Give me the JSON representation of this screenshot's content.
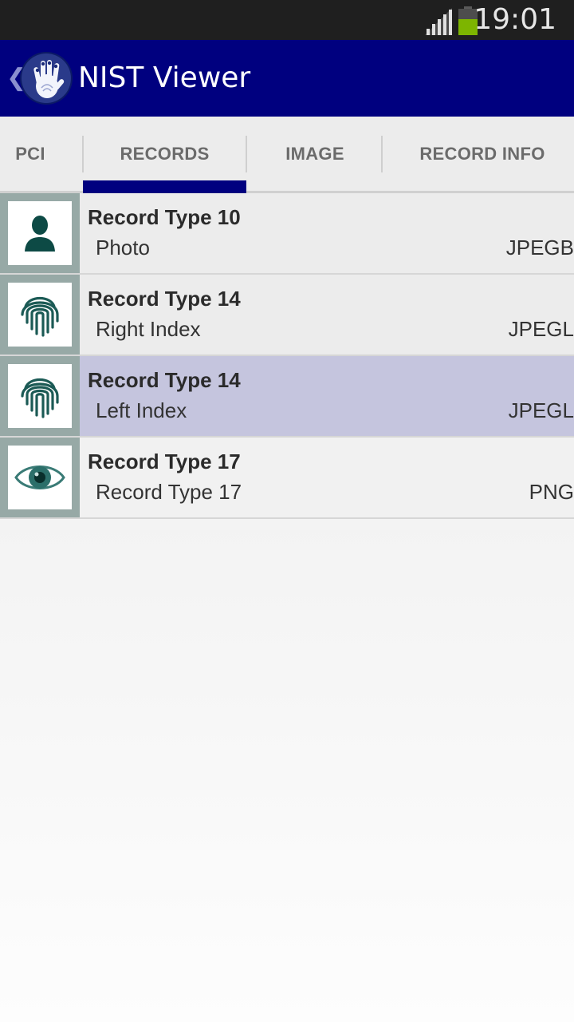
{
  "status_bar": {
    "time": "19:01",
    "signal_icon": "signal-bars-icon",
    "battery_icon": "battery-icon",
    "battery_color": "#7db500"
  },
  "action_bar": {
    "title": "NIST Viewer",
    "background": "#00007f",
    "logo_icon": "hand-fingerprint-logo"
  },
  "tabs": [
    {
      "label": "PCI"
    },
    {
      "label": "RECORDS",
      "selected": true
    },
    {
      "label": "IMAGE"
    },
    {
      "label": "RECORD INFO"
    }
  ],
  "records": [
    {
      "title": "Record Type 10",
      "subtitle": "Photo",
      "format": "JPEGB",
      "icon": "person-icon"
    },
    {
      "title": "Record Type 14",
      "subtitle": "Right Index",
      "format": "JPEGL",
      "icon": "fingerprint-icon"
    },
    {
      "title": "Record Type 14",
      "subtitle": "Left Index",
      "format": "JPEGL",
      "icon": "fingerprint-icon",
      "selected": true
    },
    {
      "title": "Record Type 17",
      "subtitle": "Record Type 17",
      "format": "PNG",
      "icon": "eye-icon"
    }
  ]
}
